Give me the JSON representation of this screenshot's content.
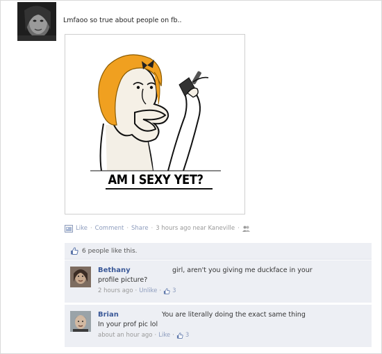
{
  "post": {
    "text": "Lmfaoo so true about people on fb..",
    "image_caption": "AM I SEXY YET?",
    "actions": {
      "like": "Like",
      "comment": "Comment",
      "share": "Share",
      "time": "3 hours ago near Kaneville",
      "separator": "·"
    }
  },
  "likes": {
    "text": "6 people like this."
  },
  "comments": [
    {
      "name": "Bethany",
      "line1": "girl, aren't you giving me duckface in your",
      "line2": "profile picture?",
      "time": "2 hours ago",
      "action": "Unlike",
      "like_count": "3"
    },
    {
      "name": "Brian",
      "line1": "You are literally doing the exact same thing",
      "line2": "In your prof pic lol",
      "time": "about an hour ago",
      "action": "Like",
      "like_count": "3"
    }
  ],
  "icons": {
    "post_type": "photo-icon",
    "privacy": "friends-icon",
    "like": "thumbs-up-icon"
  },
  "colors": {
    "link_blue": "#3b5998",
    "muted_link": "#8d9cbd",
    "comment_bg": "#edeff4",
    "meme_hair": "#f0a020"
  }
}
